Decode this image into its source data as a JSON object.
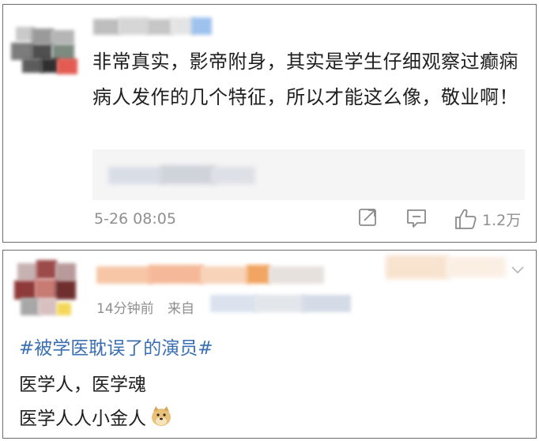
{
  "card1": {
    "comment": "非常真实，影帝附身，其实是学生仔细观察过癫痫病人发作的几个特征，所以才能这么像，敬业啊！",
    "time": "5-26 08:05",
    "like_count": "1.2万",
    "icons": [
      "share-icon",
      "comment-icon",
      "like-icon"
    ]
  },
  "card2": {
    "time_prefix": "14分钟前",
    "source_prefix": "来自",
    "hashtag": "#被学医耽误了的演员#",
    "line1": "医学人，医学魂",
    "line2": "医学人人小金人",
    "emoji": "doge-emoji",
    "icons": [
      "chevron-down-icon"
    ]
  }
}
